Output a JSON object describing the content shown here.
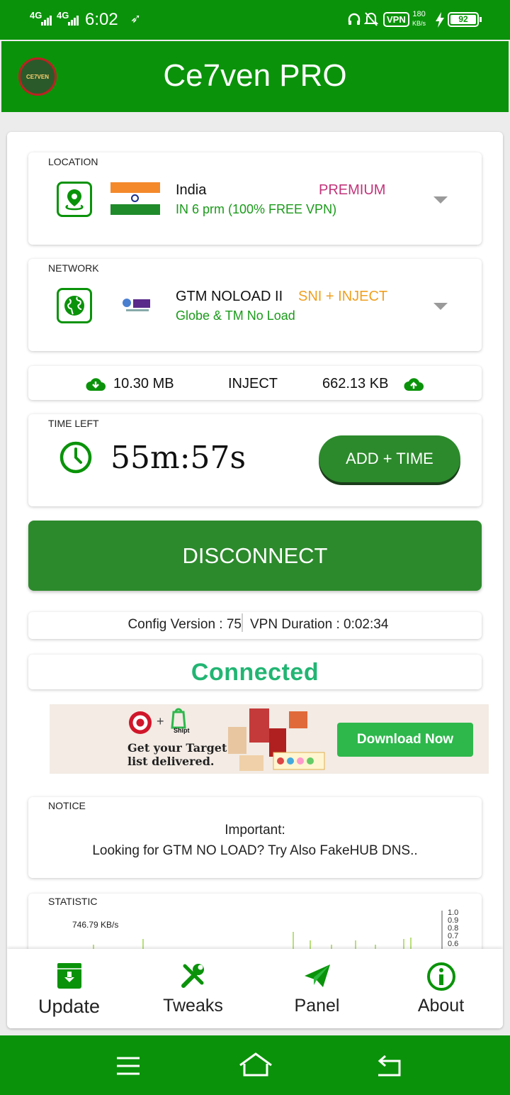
{
  "status_bar": {
    "signal_1": "4G",
    "signal_2": "4G",
    "time": "6:02",
    "vpn_badge": "VPN",
    "speed_value": "180",
    "speed_unit": "KB/s",
    "battery": "92"
  },
  "app_bar": {
    "title": "Ce7ven PRO",
    "logo_text": "CE7VEN"
  },
  "location": {
    "label": "LOCATION",
    "country": "India",
    "tier": "PREMIUM",
    "server": "IN 6 prm (100% FREE VPN)"
  },
  "network": {
    "label": "NETWORK",
    "name": "GTM NOLOAD II",
    "method": "SNI + INJECT",
    "description": "Globe & TM No Load",
    "logo_text": "Globe TM"
  },
  "traffic": {
    "download": "10.30 MB",
    "mode": "INJECT",
    "upload": "662.13 KB"
  },
  "time_left": {
    "label": "TIME LEFT",
    "value": "55m:57s",
    "add_button": "ADD + TIME"
  },
  "disconnect_button": "DISCONNECT",
  "info": {
    "config_version": "Config Version : 75",
    "vpn_duration": "VPN Duration : 0:02:34"
  },
  "connection_status": "Connected",
  "ad": {
    "tagline_1": "Get your Target",
    "tagline_2": "list delivered.",
    "shipt": "Shipt",
    "cta": "Download Now"
  },
  "notice": {
    "label": "NOTICE",
    "line_1": "Important:",
    "line_2": "Looking for GTM NO LOAD? Try Also FakeHUB DNS.."
  },
  "statistic": {
    "label": "STATISTIC",
    "speed": "746.79 KB/s",
    "axis_ticks": [
      "1.0",
      "0.9",
      "0.8",
      "0.7",
      "0.6"
    ]
  },
  "bottom_nav": {
    "items": [
      {
        "label": "Update",
        "icon": "download-box-icon"
      },
      {
        "label": "Tweaks",
        "icon": "tools-icon"
      },
      {
        "label": "Panel",
        "icon": "paper-plane-icon"
      },
      {
        "label": "About",
        "icon": "info-circle-icon"
      }
    ]
  },
  "colors": {
    "primary": "#0a930a",
    "button_green": "#2c8a2c",
    "premium": "#c2347a",
    "sni_inject": "#f0a020",
    "connected": "#22b573"
  }
}
